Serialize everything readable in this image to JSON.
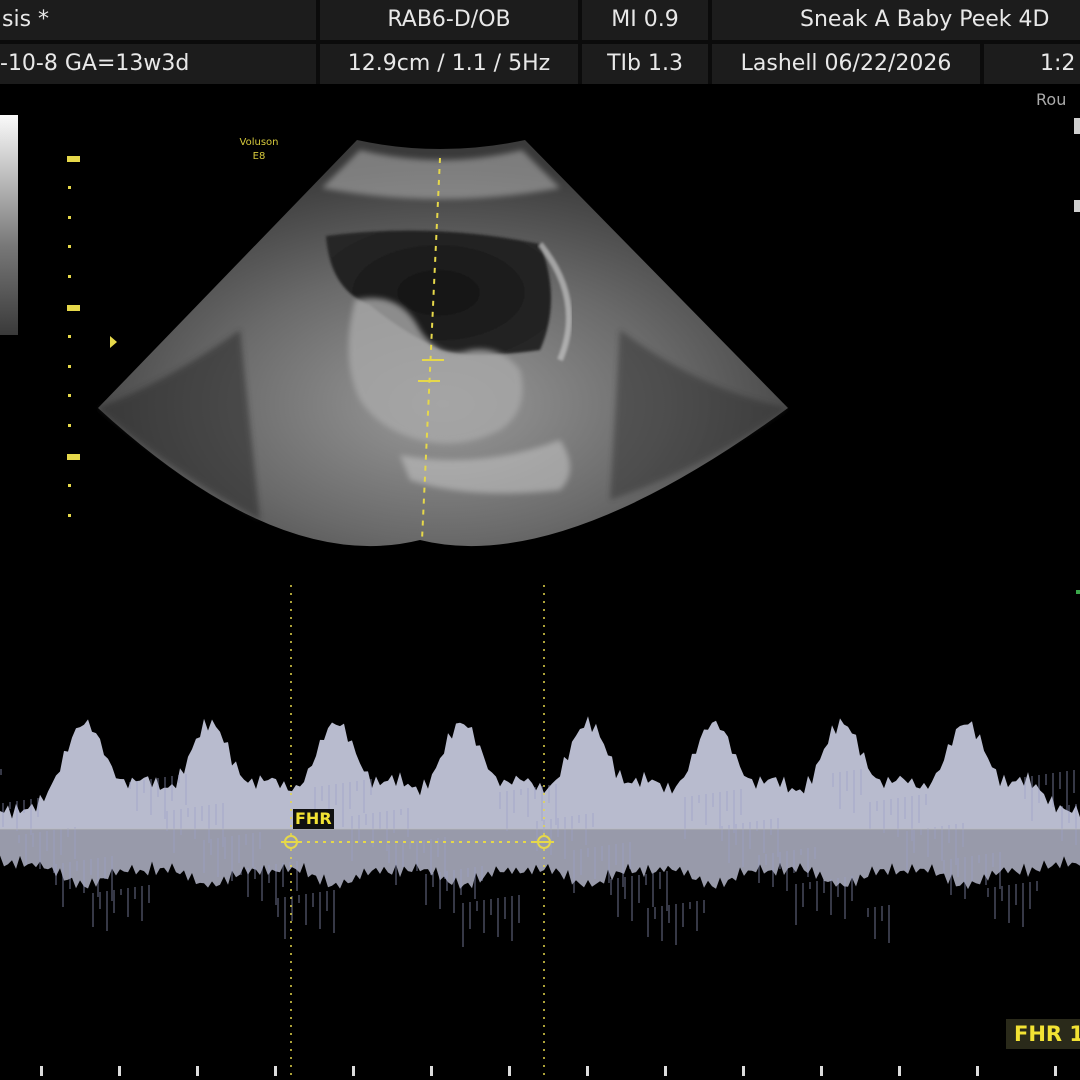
{
  "header": {
    "row1": {
      "patient": "sis *",
      "probe_preset": "RAB6-D/OB",
      "mi": "MI  0.9",
      "clinic": "Sneak A Baby Peek 4D"
    },
    "row2": {
      "exam": "-10-8  GA=13w3d",
      "params": "12.9cm / 1.1 /  5Hz",
      "tib": "TIb  1.3",
      "operator_date": "Lashell  06/22/2026",
      "time": "1:2"
    }
  },
  "roi_label": "Rou",
  "brand": {
    "line1": "Voluson",
    "line2": "E8"
  },
  "measurement": {
    "fhr_tag": "FHR",
    "fhr_result": "FHR 1"
  },
  "colors": {
    "background": "#000000",
    "header_cell": "#1c1c1c",
    "annotation_yellow": "#f2e234",
    "doppler_trace": "#d8dcf2"
  },
  "icons": {
    "depth_scale": "depth-scale",
    "focus_marker": "focus-triangle-icon",
    "caliper": "caliper-cross-icon"
  }
}
